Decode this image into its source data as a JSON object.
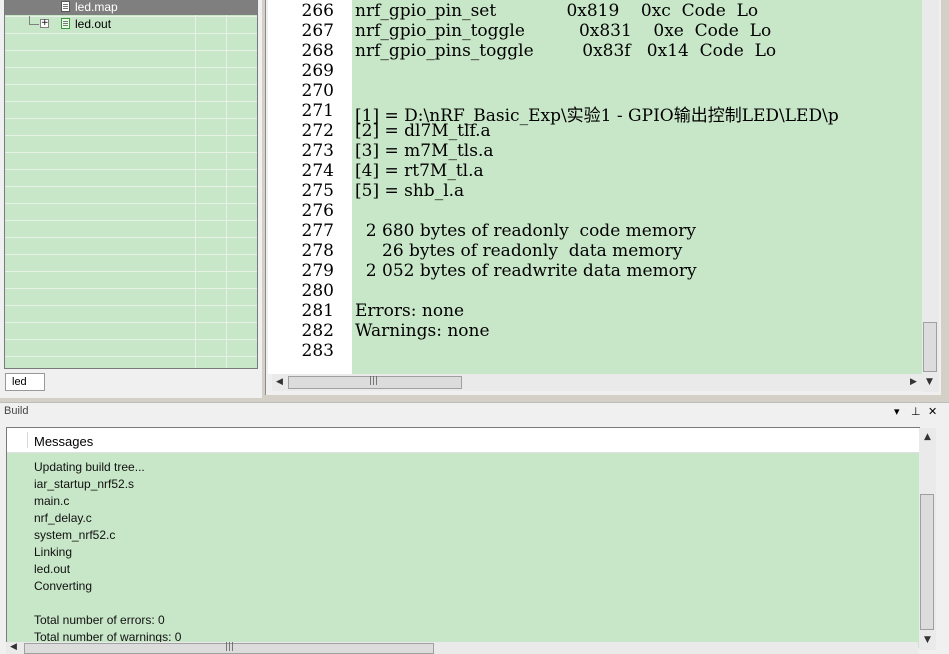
{
  "workspace": {
    "tree_items": [
      {
        "label": "led.map",
        "selected": true,
        "icon": "map-file-icon"
      },
      {
        "label": "led.out",
        "selected": false,
        "icon": "output-file-icon"
      }
    ],
    "tab_label": "led"
  },
  "editor": {
    "lines": [
      {
        "num": "266",
        "text": "nrf_gpio_pin_set             0x819    0xc  Code  Lo"
      },
      {
        "num": "267",
        "text": "nrf_gpio_pin_toggle          0x831    0xe  Code  Lo"
      },
      {
        "num": "268",
        "text": "nrf_gpio_pins_toggle         0x83f   0x14  Code  Lo"
      },
      {
        "num": "269",
        "text": ""
      },
      {
        "num": "270",
        "text": ""
      },
      {
        "num": "271",
        "text": "[1] = D:\\nRF_Basic_Exp\\实验1 - GPIO输出控制LED\\LED\\p"
      },
      {
        "num": "272",
        "text": "[2] = dl7M_tlf.a"
      },
      {
        "num": "273",
        "text": "[3] = m7M_tls.a"
      },
      {
        "num": "274",
        "text": "[4] = rt7M_tl.a"
      },
      {
        "num": "275",
        "text": "[5] = shb_l.a"
      },
      {
        "num": "276",
        "text": ""
      },
      {
        "num": "277",
        "text": "  2 680 bytes of readonly  code memory"
      },
      {
        "num": "278",
        "text": "     26 bytes of readonly  data memory"
      },
      {
        "num": "279",
        "text": "  2 052 bytes of readwrite data memory"
      },
      {
        "num": "280",
        "text": ""
      },
      {
        "num": "281",
        "text": "Errors: none"
      },
      {
        "num": "282",
        "text": "Warnings: none"
      },
      {
        "num": "283",
        "text": ""
      }
    ]
  },
  "build": {
    "title": "Build",
    "buttons": {
      "dropdown": "▾",
      "pin": "⊥",
      "close": "✕"
    },
    "header": "Messages",
    "messages": [
      "Updating build tree...",
      "iar_startup_nrf52.s",
      "main.c",
      "nrf_delay.c",
      "system_nrf52.c",
      "Linking",
      "led.out",
      "Converting",
      "",
      "Total number of errors: 0",
      "Total number of warnings: 0"
    ]
  },
  "colors": {
    "content_bg": "#c8e6c8",
    "selection": "#7f7f7f"
  }
}
